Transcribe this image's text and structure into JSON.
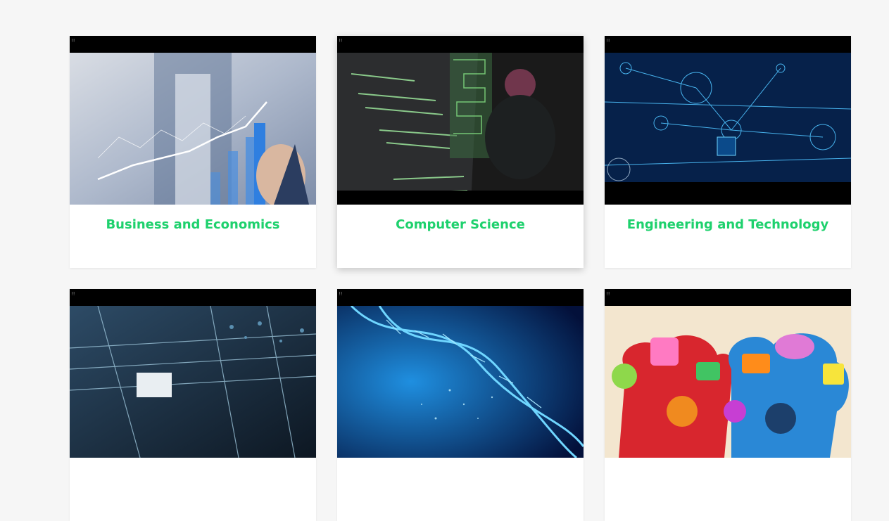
{
  "cards": [
    {
      "title": "Business and Economics",
      "image_icon": "business-chart-image"
    },
    {
      "title": "Computer Science",
      "image_icon": "code-screen-image"
    },
    {
      "title": "Engineering and Technology",
      "image_icon": "circuit-network-image"
    },
    {
      "title": "",
      "image_icon": "circuit-board-image"
    },
    {
      "title": "",
      "image_icon": "dna-helix-image"
    },
    {
      "title": "",
      "image_icon": "social-gears-image"
    }
  ],
  "colors": {
    "accent": "#1ed16d",
    "background": "#f6f6f6",
    "card": "#ffffff"
  }
}
